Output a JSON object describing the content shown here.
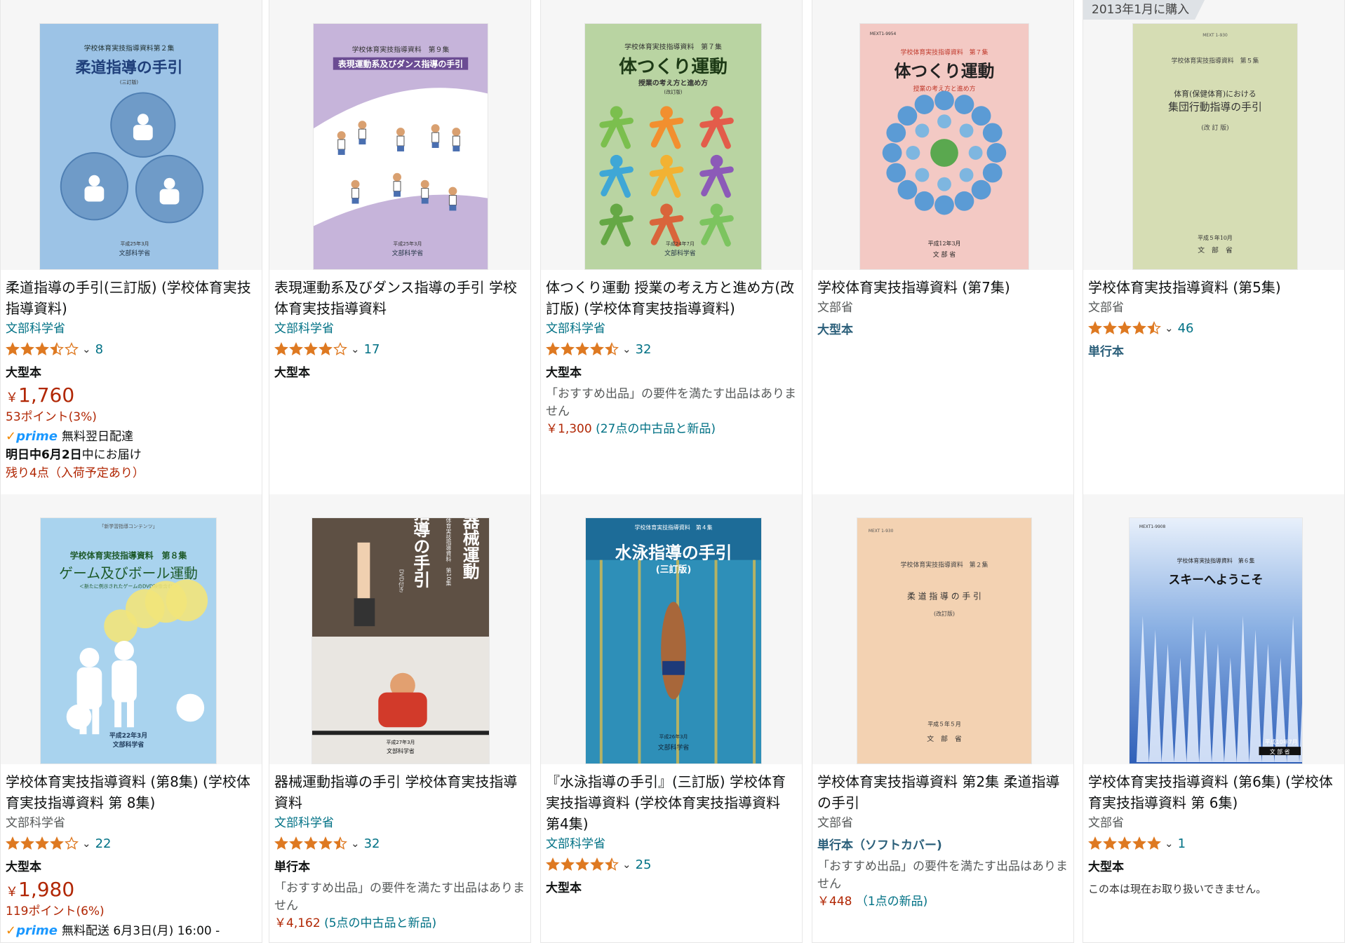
{
  "colors": {
    "link": "#007185",
    "price": "#b12704",
    "star": "#de7921",
    "prime": "#1a98ff"
  },
  "purchase_badge": "2013年1月に購入",
  "products": [
    {
      "title": "柔道指導の手引(三訂版) (学校体育実技指導資料)",
      "author": "文部科学省",
      "author_style": "link",
      "rating": 3.5,
      "rating_count": "8",
      "format": "大型本",
      "price_symbol": "￥",
      "price": "1,760",
      "points": "53ポイント(3%)",
      "prime": "prime",
      "prime_text": "無料翌日配達",
      "delivery_bold": "明日中6月2日",
      "delivery_rest": "中にお届け",
      "stock": "残り4点（入荷予定あり）",
      "cover": {
        "bg": "#9cc3e6",
        "series": "学校体育実技指導資料第２集",
        "title": "柔道指導の手引",
        "edition": "(三訂版)",
        "date": "平成25年3月",
        "pub": "文部科学省",
        "icon": "judo-cover-art"
      }
    },
    {
      "title": "表現運動系及びダンス指導の手引 学校体育実技指導資料",
      "author": "文部科学省",
      "author_style": "link",
      "rating": 4.0,
      "rating_count": "17",
      "format": "大型本",
      "cover": {
        "bg": "#c6b4da",
        "series": "学校体育実技指導資料　第９集",
        "title": "表現運動系及びダンス指導の手引",
        "date": "平成25年3月",
        "pub": "文部科学省",
        "icon": "dance-cover-art"
      }
    },
    {
      "title": "体つくり運動 授業の考え方と進め方(改訂版) (学校体育実技指導資料)",
      "author": "文部科学省",
      "author_style": "link",
      "rating": 4.5,
      "rating_count": "32",
      "format": "大型本",
      "note": "「おすすめ出品」の要件を満たす出品はありません",
      "offer_price": "￥1,300",
      "offer_count": "(27点の中古品と新品)",
      "cover": {
        "bg": "#b9d4a2",
        "series": "学校体育実技指導資料　第７集",
        "title": "体つくり運動",
        "subtitle": "授業の考え方と進め方",
        "edition": "(改訂版)",
        "date": "平成24年7月",
        "pub": "文部科学省",
        "icon": "body-exercise-cover-art"
      }
    },
    {
      "title": "学校体育実技指導資料 (第7集)",
      "author": "文部省",
      "author_style": "plain",
      "format": "大型本",
      "format_style": "teal",
      "cover": {
        "bg": "#f3c9c4",
        "code": "MEXT1-9954",
        "series": "学校体育実技指導資料　第７集",
        "title": "体つくり運動",
        "subtitle": "授業の考え方と進め方",
        "date": "平成12年3月",
        "pub": "文 部 省",
        "icon": "circle-figures-cover-art"
      }
    },
    {
      "title": "学校体育実技指導資料 (第5集)",
      "author": "文部省",
      "author_style": "plain",
      "rating": 4.5,
      "rating_count": "46",
      "format": "単行本",
      "format_style": "teal",
      "cover": {
        "bg": "#d6ddb4",
        "code": "MEXT 1-930",
        "series": "学校体育実技指導資料　第５集",
        "title1": "体育(保健体育)における",
        "title": "集団行動指導の手引",
        "edition": "(改 訂 版)",
        "date": "平成５年10月",
        "pub": "文　部　省",
        "icon": "plain-cover-art"
      }
    },
    {
      "title": "学校体育実技指導資料 (第8集) (学校体育実技指導資料 第 8集)",
      "author": "文部科学省",
      "author_style": "plain",
      "rating": 4.0,
      "rating_count": "22",
      "format": "大型本",
      "price_symbol": "￥",
      "price": "1,980",
      "points": "119ポイント(6%)",
      "prime": "prime",
      "prime_text": "無料配送 6月3日(月) 16:00 -",
      "cover": {
        "bg": "#a9d3ee",
        "top": "「新学習指導コンテンツ」",
        "series": "学校体育実技指導資料　第８集",
        "title": "ゲーム及びボール運動",
        "subtitle": "＜新たに例示されたゲームのDVD映像含む＞",
        "date": "平成22年3月",
        "pub": "文部科学省",
        "icon": "ball-game-cover-art"
      }
    },
    {
      "title": "器械運動指導の手引 学校体育実技指導資料",
      "author": "文部科学省",
      "author_style": "link",
      "rating": 4.5,
      "rating_count": "32",
      "format": "単行本",
      "note": "「おすすめ出品」の要件を満たす出品はありません",
      "offer_price": "￥4,162",
      "offer_count": "(5点の中古品と新品)",
      "cover": {
        "bg": "#5e5044",
        "series": "学校体育実技指導資料　第10集",
        "title": "器械運動",
        "title2": "指導の手引",
        "subtitle": "DVD付き",
        "date": "平成27年3月",
        "pub": "文部科学省",
        "icon": "gymnastics-cover-art"
      }
    },
    {
      "title": "『水泳指導の手引』(三訂版) 学校体育実技指導資料 (学校体育実技指導資料 第4集)",
      "author": "文部科学省",
      "author_style": "link",
      "rating": 4.5,
      "rating_count": "25",
      "format": "大型本",
      "cover": {
        "bg": "#2e8fb8",
        "series": "学校体育実技指導資料　第４集",
        "title": "水泳指導の手引",
        "edition": "(三訂版)",
        "date": "平成26年3月",
        "pub": "文部科学省",
        "icon": "swimming-cover-art"
      }
    },
    {
      "title": "学校体育実技指導資料 第2集 柔道指導の手引",
      "author": "文部省",
      "author_style": "plain",
      "format": "単行本（ソフトカバー)",
      "format_style": "teal",
      "note": "「おすすめ出品」の要件を満たす出品はありません",
      "offer_price": "￥448",
      "offer_count": "（1点の新品)",
      "cover": {
        "bg": "#f3d2b2",
        "code": "MEXT 1-930",
        "series": "学校体育実技指導資料　第２集",
        "title": "柔 道 指 導 の 手 引",
        "edition": "(改訂版)",
        "date": "平成５年５月",
        "pub": "文　部　省",
        "icon": "plain-cover-art"
      }
    },
    {
      "title": "学校体育実技指導資料 (第6集) (学校体育実技指導資料 第 6集)",
      "author": "文部省",
      "author_style": "plain",
      "rating": 5.0,
      "rating_count": "1",
      "format": "大型本",
      "small_note": "この本は現在お取り扱いできません。",
      "cover": {
        "bg": "#5f8fd0",
        "code": "MEXT1-9908",
        "series": "学校体育実技指導資料　第６集",
        "title": "スキーへようこそ",
        "date": "平成10年7月",
        "pub": "文 部 省",
        "icon": "snow-trees-cover-art"
      }
    }
  ]
}
